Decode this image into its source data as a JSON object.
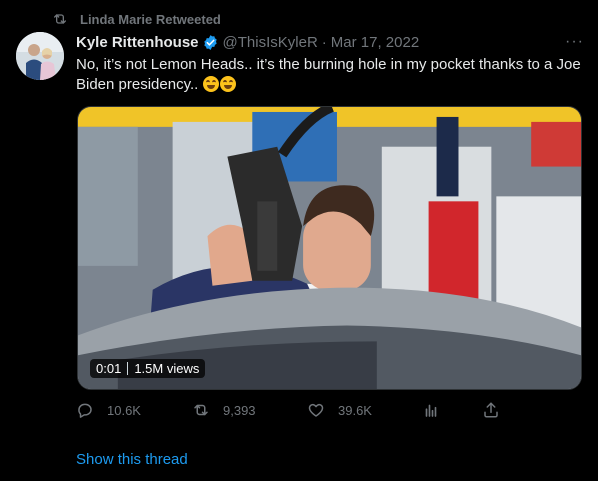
{
  "retweet": {
    "label": "Linda Marie Retweeted",
    "icon": "retweet-icon"
  },
  "author": {
    "name": "Kyle Rittenhouse",
    "handle": "@ThisIsKyleR",
    "separator": "·",
    "date": "Mar 17, 2022",
    "verified": true,
    "verified_color": "#1d9bf0"
  },
  "more_label": "···",
  "tweet": {
    "text": "No, it’s not Lemon Heads.. it’s the burning hole in my pocket thanks to a Joe Biden presidency..",
    "emojis": [
      "face-with-tears-of-joy",
      "face-with-tears-of-joy"
    ]
  },
  "video": {
    "duration": "0:01",
    "views": "1.5M views"
  },
  "actions": {
    "reply": {
      "icon": "reply-icon",
      "count": "10.6K"
    },
    "retweet": {
      "icon": "retweet-icon",
      "count": "9,393"
    },
    "like": {
      "icon": "heart-icon",
      "count": "39.6K"
    },
    "analytics": {
      "icon": "analytics-icon"
    },
    "share": {
      "icon": "share-icon"
    }
  },
  "show_thread": "Show this thread",
  "colors": {
    "background": "#000000",
    "text": "#e7e9ea",
    "muted": "#71767b",
    "accent": "#1d9bf0"
  }
}
